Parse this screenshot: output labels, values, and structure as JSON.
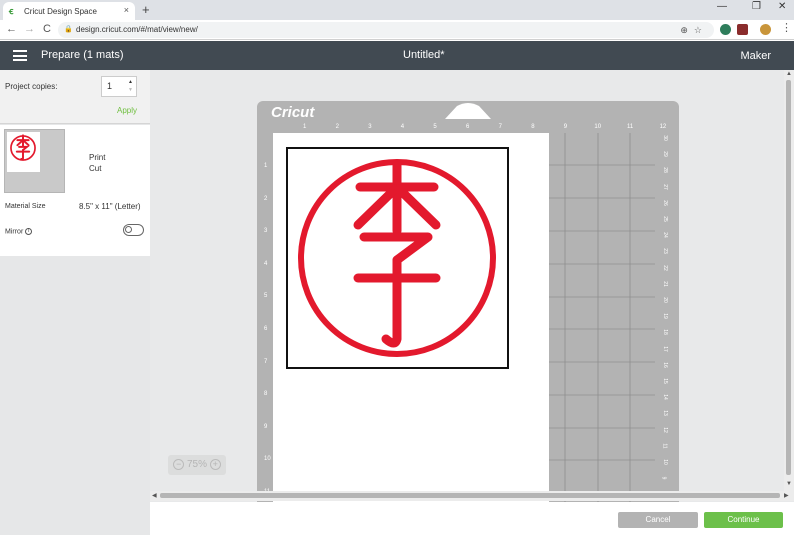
{
  "browser": {
    "tab_title": "Cricut Design Space",
    "tab_close": "×",
    "new_tab": "+",
    "window_controls": [
      "—",
      "❐",
      "✕"
    ],
    "nav": [
      "←",
      "→",
      "C"
    ],
    "url": "design.cricut.com/#/mat/view/new/"
  },
  "header": {
    "menu_icon": "hamburger-icon",
    "prepare_title": "Prepare (1 mats)",
    "document_title": "Untitled*",
    "machine": "Maker"
  },
  "left_panel": {
    "project_copies_label": "Project copies:",
    "project_copies_value": "1",
    "apply_label": "Apply",
    "mat_mode": [
      "Print",
      "Cut"
    ],
    "material_size_label": "Material Size",
    "material_size_value": "8.5\" x 11\" (Letter)",
    "mirror_label": "Mirror",
    "mirror_info": "i",
    "mirror_on": false
  },
  "mat": {
    "logo": "Cricut",
    "ruler_top": [
      "1",
      "2",
      "3",
      "4",
      "5",
      "6",
      "7",
      "8",
      "9",
      "10",
      "11",
      "12"
    ],
    "ruler_left": [
      "1",
      "2",
      "3",
      "4",
      "5",
      "6",
      "7",
      "8",
      "9",
      "10",
      "11"
    ],
    "ruler_right": [
      "30",
      "29",
      "28",
      "27",
      "26",
      "25",
      "24",
      "23",
      "22",
      "21",
      "20",
      "19",
      "18",
      "17",
      "16",
      "15",
      "14",
      "13",
      "12",
      "11",
      "10",
      "9",
      "8"
    ],
    "accent_color": "#e3192d"
  },
  "zoom": {
    "minus": "−",
    "level": "75%",
    "plus": "+"
  },
  "footer": {
    "cancel_label": "Cancel",
    "continue_label": "Continue"
  },
  "colors": {
    "header_bg": "#414a52",
    "continue_green": "#6cc04a",
    "apply_green": "#6fbf3f",
    "design_red": "#e3192d"
  }
}
